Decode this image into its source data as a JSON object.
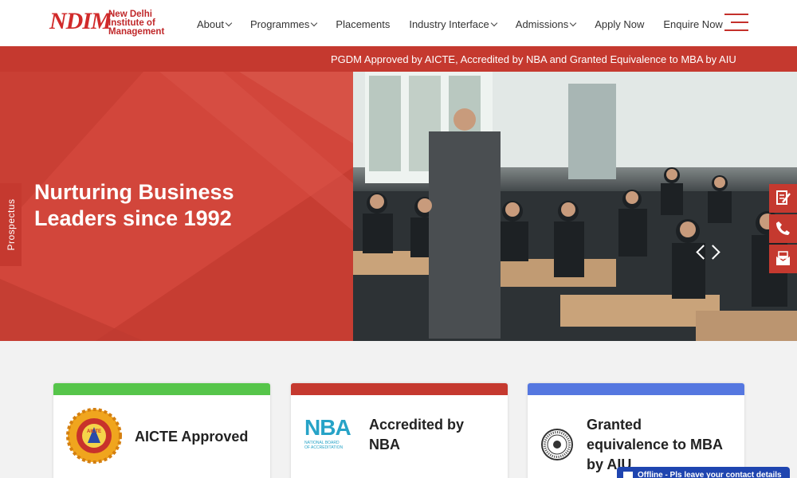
{
  "header": {
    "logo": {
      "mark": "NDIM",
      "line1": "New Delhi",
      "line2": "Institute of",
      "line3": "Management"
    },
    "nav": [
      {
        "label": "About",
        "dropdown": true
      },
      {
        "label": "Programmes",
        "dropdown": true
      },
      {
        "label": "Placements",
        "dropdown": false
      },
      {
        "label": "Industry Interface",
        "dropdown": true
      },
      {
        "label": "Admissions",
        "dropdown": true
      },
      {
        "label": "Apply Now",
        "dropdown": false
      },
      {
        "label": "Enquire Now",
        "dropdown": false
      }
    ],
    "menu_icon": "hamburger-icon"
  },
  "announcement": "PGDM Approved by AICTE, Accredited by NBA and Granted Equivalence to MBA by AIU",
  "hero": {
    "title_line1": "Nurturing Business",
    "title_line2": "Leaders since 1992",
    "photo_subject": "classroom-lecture-photo"
  },
  "prospectus_tab": "Prospectus",
  "side_icons": [
    "document-edit-icon",
    "phone-icon",
    "mail-icon"
  ],
  "cards": [
    {
      "label": "AICTE Approved",
      "accent": "#56c54a",
      "logo": "aicte-logo"
    },
    {
      "label_line1": "Accredited by",
      "label_line2": "NBA",
      "accent": "#c5392f",
      "logo": "nba-logo",
      "logo_text": "NBA",
      "logo_sub1": "NATIONAL BOARD",
      "logo_sub2": "OF ACCREDITATION"
    },
    {
      "label_line1": "Granted",
      "label_line2": "equivalence to MBA",
      "label_line3": "by AIU",
      "accent": "#5577e0",
      "logo": "aiu-logo"
    }
  ],
  "chat": {
    "label": "Offline - Pls leave your contact details"
  },
  "colors": {
    "brand_red": "#c5392f",
    "hero_red": "#d2463b",
    "green": "#56c54a",
    "blue": "#5577e0"
  }
}
